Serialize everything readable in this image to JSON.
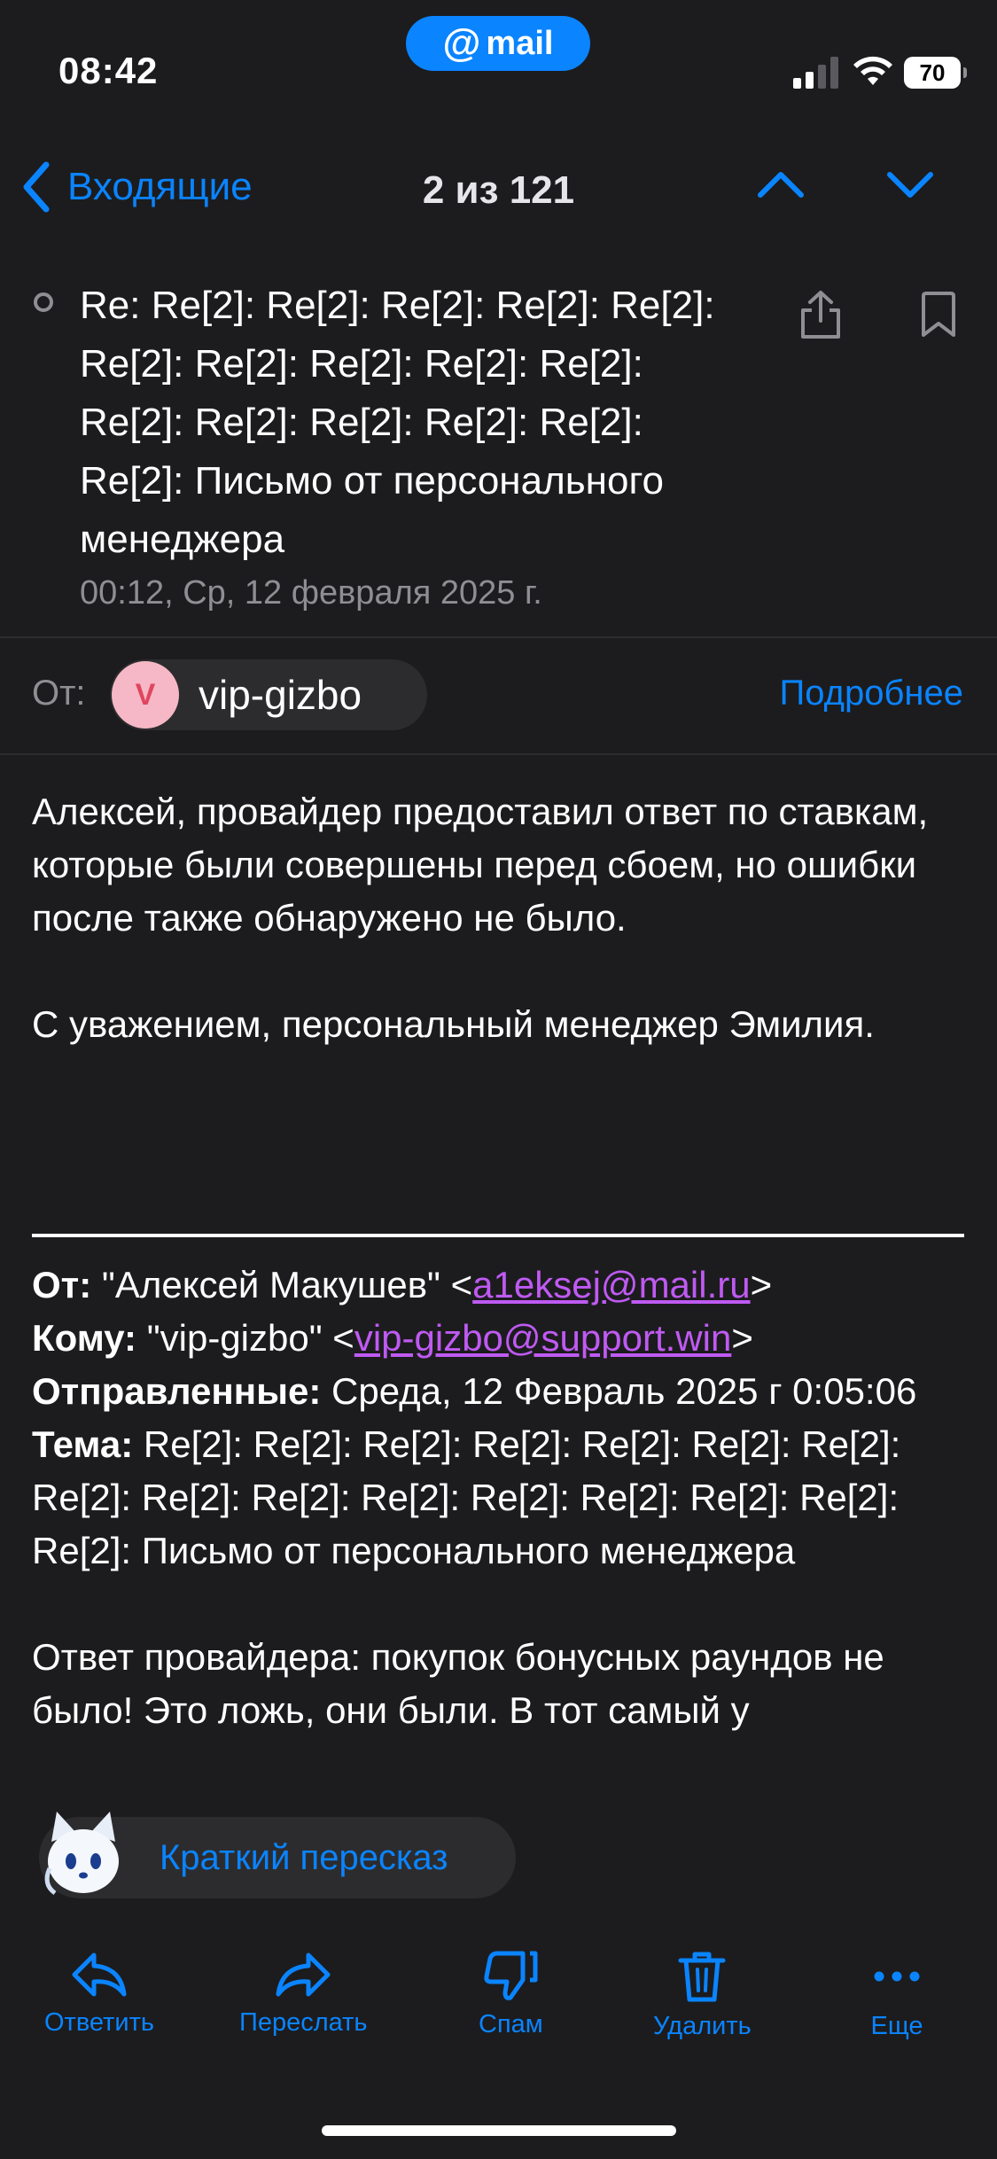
{
  "status_bar": {
    "time": "08:42",
    "brand": "mail",
    "battery": "70"
  },
  "nav": {
    "back_label": "Входящие",
    "counter": "2 из 121"
  },
  "message": {
    "subject": "Re: Re[2]: Re[2]: Re[2]: Re[2]: Re[2]: Re[2]: Re[2]: Re[2]: Re[2]: Re[2]: Re[2]: Re[2]: Re[2]: Re[2]: Re[2]: Re[2]: Письмо от персонального менеджера",
    "date": "00:12, Ср, 12 февраля 2025 г.",
    "from_label": "От:",
    "sender_initial": "V",
    "sender_name": "vip-gizbo",
    "details_label": "Подробнее",
    "body_paragraph": "Алексей, провайдер предоставил ответ по ставкам, которые были совершены перед сбоем, но ошибки после также обнаружено не было.",
    "signature": "С уважением, персональный менеджер Эмилия."
  },
  "quoted": {
    "from_key": "От:",
    "from_name": "\"Алексей Макушев\" <",
    "from_email": "a1eksej@mail.ru",
    "from_close": ">",
    "to_key": "Кому:",
    "to_name": "\"vip-gizbo\" <",
    "to_email": "vip-gizbo@support.win",
    "to_close": ">",
    "sent_key": "Отправленные:",
    "sent_value": "Среда, 12 Февраль 2025 г 0:05:06",
    "subject_key": "Тема:",
    "subject_value": "Re[2]: Re[2]: Re[2]: Re[2]: Re[2]: Re[2]: Re[2]: Re[2]: Re[2]: Re[2]: Re[2]: Re[2]: Re[2]: Re[2]: Re[2]: Re[2]: Письмо от персонального менеджера",
    "reply_text": "Ответ провайдера: покупок бонусных раундов не было! Это ложь, они были. В тот самый у"
  },
  "summary": {
    "label": "Краткий пересказ"
  },
  "toolbar": {
    "reply": "Ответить",
    "forward": "Переслать",
    "spam": "Спам",
    "delete": "Удалить",
    "more": "Еще"
  },
  "colors": {
    "background": "#1c1c1e",
    "accent": "#0a84ff",
    "link": "#bf5af2",
    "avatar_bg": "#f6b8c6",
    "avatar_fg": "#e0455f"
  }
}
